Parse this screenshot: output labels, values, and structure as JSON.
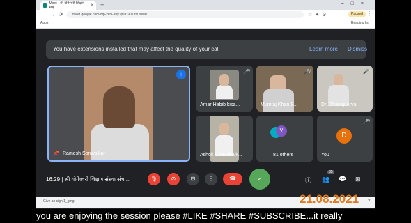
{
  "browser": {
    "tab_title": "Meet - श्री योगेश्वरी शिक्षण संस्...",
    "url": "meet.google.com/ofp-xkfs-sny?pli=1&authuser=0",
    "paused_label": "Paused",
    "apps_label": "Apps",
    "reading_list_label": "Reading list"
  },
  "banner": {
    "message": "You have extensions installed that may affect the quality of your call",
    "learn_more": "Learn more",
    "dismiss": "Dismiss"
  },
  "participants": {
    "main": {
      "name": "Ramesh Sonwalkar"
    },
    "tiles": [
      {
        "name": "Amar Habib kisa..."
      },
      {
        "name": "Mumtaj Khan S..."
      },
      {
        "name": "Dr. Dhanaji Arya"
      },
      {
        "name": "Ashok Chaudhalk..."
      },
      {
        "name": "81 others",
        "avatar": "V"
      },
      {
        "name": "You",
        "avatar": "D"
      }
    ]
  },
  "controls": {
    "time": "16:29",
    "meeting_title": "श्री योगेश्वरी शिक्षण संस्था संचा...",
    "people_count": "85"
  },
  "download": {
    "file": "Give an sign 1_.png"
  },
  "overlay": {
    "date": "21.08.2021",
    "ticker": "you are enjoying the session please #LIKE #SHARE #SUBSCRIBE...it really"
  }
}
